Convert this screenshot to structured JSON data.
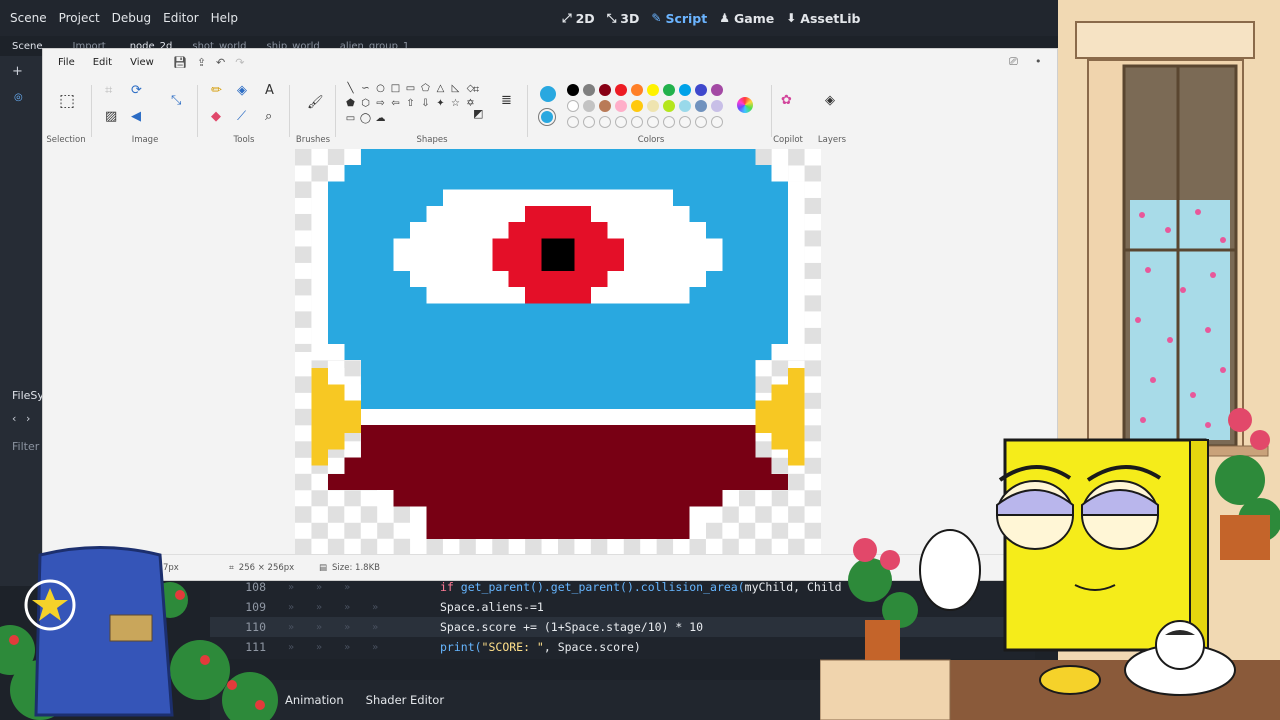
{
  "godot": {
    "menus": [
      "Scene",
      "Project",
      "Debug",
      "Editor",
      "Help"
    ],
    "workspaces": [
      {
        "label": "2D",
        "icon": "2d-icon",
        "glyph": "⤢"
      },
      {
        "label": "3D",
        "icon": "3d-icon",
        "glyph": "⤡"
      },
      {
        "label": "Script",
        "icon": "script-icon",
        "glyph": "✎",
        "active": true
      },
      {
        "label": "Game",
        "icon": "game-icon",
        "glyph": "♟"
      },
      {
        "label": "AssetLib",
        "icon": "assetlib-icon",
        "glyph": "⬇"
      }
    ],
    "tabs": {
      "scene": "Scene",
      "import": "Import",
      "node_2d": "node_2d",
      "shot_world": "shot_world",
      "ship_world": "ship_world",
      "alien_group": "alien_group_1"
    },
    "left_dock": {
      "filesystem": "FileSy",
      "filter": "Filter"
    },
    "code": [
      {
        "line": "108",
        "text_kw": "if ",
        "text_fn": "get_parent().get_parent().collision_area(",
        "text_rest": "myChild, Chi",
        "tail": "ld"
      },
      {
        "line": "109",
        "text": "Space.aliens-=1"
      },
      {
        "line": "110",
        "text": "Space.score += (1+Space.stage/10) * 10"
      },
      {
        "line": "111",
        "text_fn": "print(",
        "text_str": "\"SCORE: \"",
        "text_rest": ", Space.score)"
      }
    ],
    "bottom_panels": [
      "Animation",
      "Shader Editor"
    ]
  },
  "paint": {
    "menus": [
      "File",
      "Edit",
      "View"
    ],
    "groups": {
      "selection": "Selection",
      "image": "Image",
      "tools": "Tools",
      "brushes": "Brushes",
      "shapes": "Shapes",
      "colors": "Colors",
      "copilot": "Copilot",
      "layers": "Layers"
    },
    "colors": {
      "primary": "#29a8e0",
      "secondary": "#29a8e0",
      "row1": [
        "#000000",
        "#7f7f7f",
        "#880015",
        "#ed1c24",
        "#ff7f27",
        "#fff200",
        "#22b14c",
        "#00a2e8",
        "#3f48cc",
        "#a349a4"
      ],
      "row2": [
        "#ffffff",
        "#c3c3c3",
        "#b97a57",
        "#ffaec9",
        "#ffc90e",
        "#efe4b0",
        "#b5e61d",
        "#99d9ea",
        "#7092be",
        "#c8bfe7"
      ]
    },
    "status": {
      "cursor": "7px",
      "image_size": "256 × 256px",
      "file_size": "Size: 1.8KB"
    }
  }
}
